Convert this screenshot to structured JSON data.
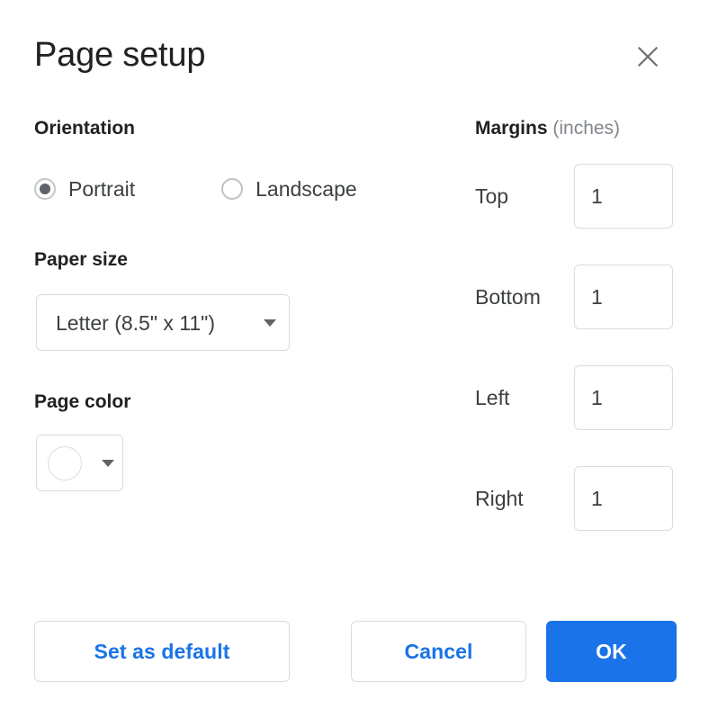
{
  "dialog": {
    "title": "Page setup",
    "close_icon": "close-icon"
  },
  "orientation": {
    "heading": "Orientation",
    "options": [
      {
        "label": "Portrait",
        "selected": true
      },
      {
        "label": "Landscape",
        "selected": false
      }
    ]
  },
  "paper_size": {
    "heading": "Paper size",
    "value": "Letter (8.5\" x 11\")",
    "caret_icon": "chevron-down-icon"
  },
  "page_color": {
    "heading": "Page color",
    "swatch_color": "#ffffff",
    "caret_icon": "chevron-down-icon"
  },
  "margins": {
    "heading": "Margins",
    "units": "(inches)",
    "fields": [
      {
        "label": "Top",
        "value": "1"
      },
      {
        "label": "Bottom",
        "value": "1"
      },
      {
        "label": "Left",
        "value": "1"
      },
      {
        "label": "Right",
        "value": "1"
      }
    ]
  },
  "footer": {
    "set_default_label": "Set as default",
    "cancel_label": "Cancel",
    "ok_label": "OK"
  },
  "colors": {
    "accent": "#1a73e8",
    "text_primary": "#202124",
    "text_body": "#3c4043",
    "text_muted": "#80868b",
    "border": "#dadce0",
    "radio_dot": "#5f6368"
  }
}
